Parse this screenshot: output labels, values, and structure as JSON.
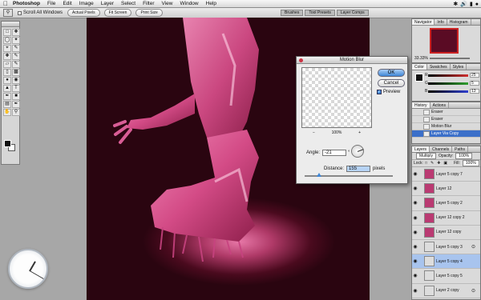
{
  "menubar": {
    "app_name": "Photoshop",
    "items": [
      "File",
      "Edit",
      "Image",
      "Layer",
      "Select",
      "Filter",
      "View",
      "Window",
      "Help"
    ]
  },
  "options_bar": {
    "scroll_all_windows": "Scroll All Windows",
    "actual_pixels": "Actual Pixels",
    "fit_screen": "Fit Screen",
    "print_size": "Print Size",
    "palette_well": [
      "Brushes",
      "Tool Presets",
      "Layer Comps"
    ]
  },
  "dialog": {
    "title": "Motion Blur",
    "ok": "OK",
    "cancel": "Cancel",
    "preview_label": "Preview",
    "zoom_value": "100%",
    "zoom_minus": "−",
    "zoom_plus": "+",
    "angle_label": "Angle:",
    "angle_value": "-21",
    "angle_unit": "°",
    "distance_label": "Distance:",
    "distance_value": "155",
    "distance_unit": "pixels",
    "distance_fraction": 0.16
  },
  "navigator": {
    "tabs": [
      "Navigator",
      "Info",
      "Histogram"
    ],
    "zoom": "33.33%"
  },
  "color_panel": {
    "tabs": [
      "Color",
      "Swatches",
      "Styles"
    ],
    "channels": [
      {
        "label": "R",
        "value": "25",
        "color": "#d03030"
      },
      {
        "label": "G",
        "value": "5",
        "color": "#30a030"
      },
      {
        "label": "B",
        "value": "13",
        "color": "#3040d0"
      }
    ]
  },
  "history": {
    "tabs": [
      "History",
      "Actions"
    ],
    "items": [
      "Eraser",
      "Eraser",
      "Motion Blur",
      "Layer Via Copy"
    ],
    "selected_index": 3
  },
  "layers": {
    "tabs": [
      "Layers",
      "Channels",
      "Paths"
    ],
    "blend_mode": "Multiply",
    "opacity_label": "Opacity:",
    "opacity": "100%",
    "lock_label": "Lock:",
    "fill_label": "Fill:",
    "fill": "100%",
    "items": [
      {
        "name": "Layer 5 copy 7",
        "thumb": "pink",
        "fx": ""
      },
      {
        "name": "Layer 12",
        "thumb": "pink",
        "fx": ""
      },
      {
        "name": "Layer 5 copy 2",
        "thumb": "pink",
        "fx": ""
      },
      {
        "name": "Layer 12 copy 2",
        "thumb": "pink",
        "fx": ""
      },
      {
        "name": "Layer 12 copy",
        "thumb": "pink",
        "fx": ""
      },
      {
        "name": "Layer 5 copy 3",
        "thumb": "lite",
        "fx": "⊙"
      },
      {
        "name": "Layer 5 copy 4",
        "thumb": "lite",
        "fx": ""
      },
      {
        "name": "Layer 5 copy 5",
        "thumb": "lite",
        "fx": ""
      },
      {
        "name": "Layer 2 copy",
        "thumb": "lite",
        "fx": "⊙"
      },
      {
        "name": "Layer 1",
        "thumb": "dark",
        "fx": ""
      }
    ],
    "selected_index": 6
  }
}
